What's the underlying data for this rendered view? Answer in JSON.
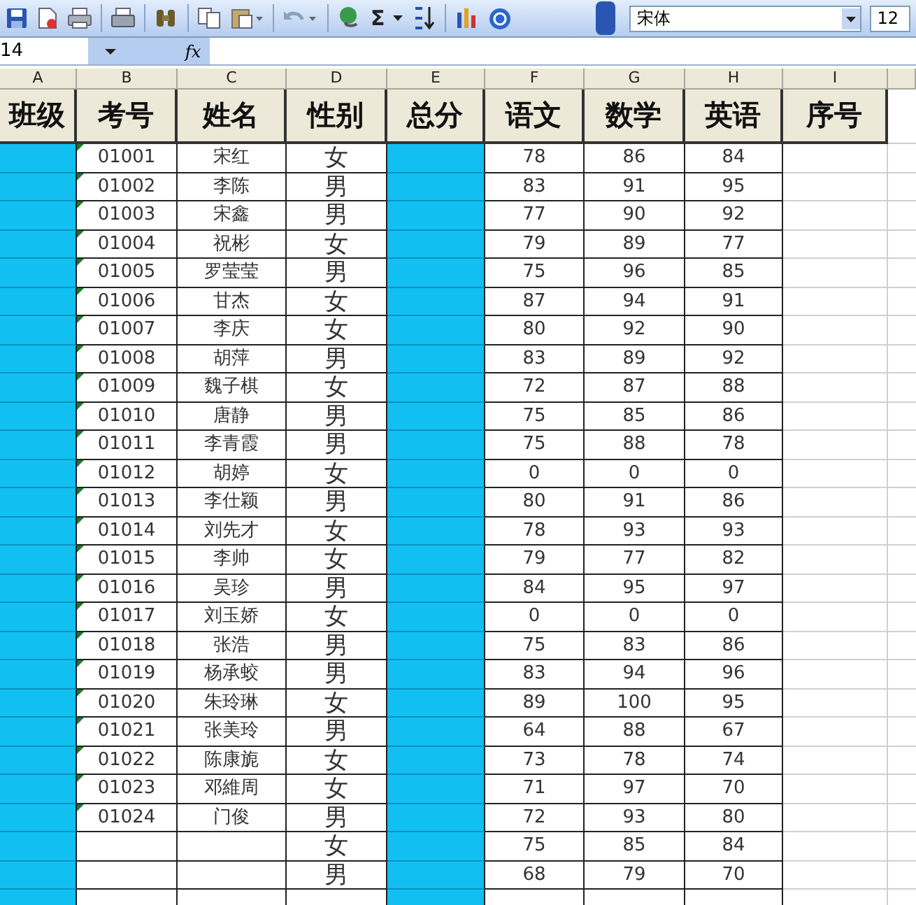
{
  "toolbar": {
    "sum_symbol": "Σ",
    "font": "宋体",
    "font_size": "12"
  },
  "formula_bar": {
    "name_box": "14",
    "fx": "fx"
  },
  "columns": [
    "A",
    "B",
    "C",
    "D",
    "E",
    "F",
    "G",
    "H",
    "I"
  ],
  "header_row": [
    "班级",
    "考号",
    "姓名",
    "性别",
    "总分",
    "语文",
    "数学",
    "英语",
    "序号"
  ],
  "rows": [
    {
      "id": "01001",
      "name": "宋红",
      "gender": "女",
      "chinese": "78",
      "math": "86",
      "english": "84"
    },
    {
      "id": "01002",
      "name": "李陈",
      "gender": "男",
      "chinese": "83",
      "math": "91",
      "english": "95"
    },
    {
      "id": "01003",
      "name": "宋鑫",
      "gender": "男",
      "chinese": "77",
      "math": "90",
      "english": "92"
    },
    {
      "id": "01004",
      "name": "祝彬",
      "gender": "女",
      "chinese": "79",
      "math": "89",
      "english": "77"
    },
    {
      "id": "01005",
      "name": "罗莹莹",
      "gender": "男",
      "chinese": "75",
      "math": "96",
      "english": "85"
    },
    {
      "id": "01006",
      "name": "甘杰",
      "gender": "女",
      "chinese": "87",
      "math": "94",
      "english": "91"
    },
    {
      "id": "01007",
      "name": "李庆",
      "gender": "女",
      "chinese": "80",
      "math": "92",
      "english": "90"
    },
    {
      "id": "01008",
      "name": "胡萍",
      "gender": "男",
      "chinese": "83",
      "math": "89",
      "english": "92"
    },
    {
      "id": "01009",
      "name": "魏子棋",
      "gender": "女",
      "chinese": "72",
      "math": "87",
      "english": "88"
    },
    {
      "id": "01010",
      "name": "唐静",
      "gender": "男",
      "chinese": "75",
      "math": "85",
      "english": "86"
    },
    {
      "id": "01011",
      "name": "李青霞",
      "gender": "男",
      "chinese": "75",
      "math": "88",
      "english": "78"
    },
    {
      "id": "01012",
      "name": "胡婷",
      "gender": "女",
      "chinese": "0",
      "math": "0",
      "english": "0"
    },
    {
      "id": "01013",
      "name": "李仕颖",
      "gender": "男",
      "chinese": "80",
      "math": "91",
      "english": "86"
    },
    {
      "id": "01014",
      "name": "刘先才",
      "gender": "女",
      "chinese": "78",
      "math": "93",
      "english": "93"
    },
    {
      "id": "01015",
      "name": "李帅",
      "gender": "女",
      "chinese": "79",
      "math": "77",
      "english": "82"
    },
    {
      "id": "01016",
      "name": "吴珍",
      "gender": "男",
      "chinese": "84",
      "math": "95",
      "english": "97"
    },
    {
      "id": "01017",
      "name": "刘玉娇",
      "gender": "女",
      "chinese": "0",
      "math": "0",
      "english": "0"
    },
    {
      "id": "01018",
      "name": "张浩",
      "gender": "男",
      "chinese": "75",
      "math": "83",
      "english": "86"
    },
    {
      "id": "01019",
      "name": "杨承蛟",
      "gender": "男",
      "chinese": "83",
      "math": "94",
      "english": "96"
    },
    {
      "id": "01020",
      "name": "朱玲琳",
      "gender": "女",
      "chinese": "89",
      "math": "100",
      "english": "95"
    },
    {
      "id": "01021",
      "name": "张美玲",
      "gender": "男",
      "chinese": "64",
      "math": "88",
      "english": "67"
    },
    {
      "id": "01022",
      "name": "陈康旎",
      "gender": "女",
      "chinese": "73",
      "math": "78",
      "english": "74"
    },
    {
      "id": "01023",
      "name": "邓維周",
      "gender": "女",
      "chinese": "71",
      "math": "97",
      "english": "70"
    },
    {
      "id": "01024",
      "name": "门俊",
      "gender": "男",
      "chinese": "72",
      "math": "93",
      "english": "80"
    },
    {
      "gender": "女",
      "chinese": "75",
      "math": "85",
      "english": "84"
    },
    {
      "gender": "男",
      "chinese": "68",
      "math": "79",
      "english": "70"
    }
  ]
}
